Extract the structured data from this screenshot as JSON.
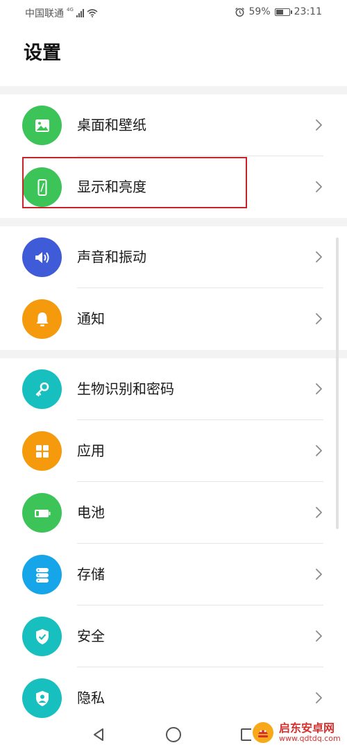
{
  "status_bar": {
    "carrier": "中国联通",
    "network": "4G",
    "battery_percent": "59%",
    "time": "23:11",
    "battery_level": 0.59
  },
  "page": {
    "title": "设置"
  },
  "groups": [
    {
      "items": [
        {
          "label": "桌面和壁纸",
          "icon": "wallpaper-icon",
          "color": "#3cc458"
        },
        {
          "label": "显示和亮度",
          "icon": "display-icon",
          "color": "#3cc458"
        }
      ]
    },
    {
      "items": [
        {
          "label": "声音和振动",
          "icon": "sound-icon",
          "color": "#3f5bd8"
        },
        {
          "label": "通知",
          "icon": "bell-icon",
          "color": "#f59a0c"
        }
      ]
    },
    {
      "items": [
        {
          "label": "生物识别和密码",
          "icon": "key-icon",
          "color": "#17bfbf"
        },
        {
          "label": "应用",
          "icon": "apps-icon",
          "color": "#f59a0c"
        },
        {
          "label": "电池",
          "icon": "battery-icon",
          "color": "#3cc458"
        },
        {
          "label": "存储",
          "icon": "storage-icon",
          "color": "#16a5e8"
        },
        {
          "label": "安全",
          "icon": "shield-check-icon",
          "color": "#17bfbf"
        },
        {
          "label": "隐私",
          "icon": "privacy-icon",
          "color": "#17bfbf"
        }
      ]
    }
  ],
  "watermark": {
    "title": "启东安卓网",
    "url": "www.qdtdq.com"
  }
}
